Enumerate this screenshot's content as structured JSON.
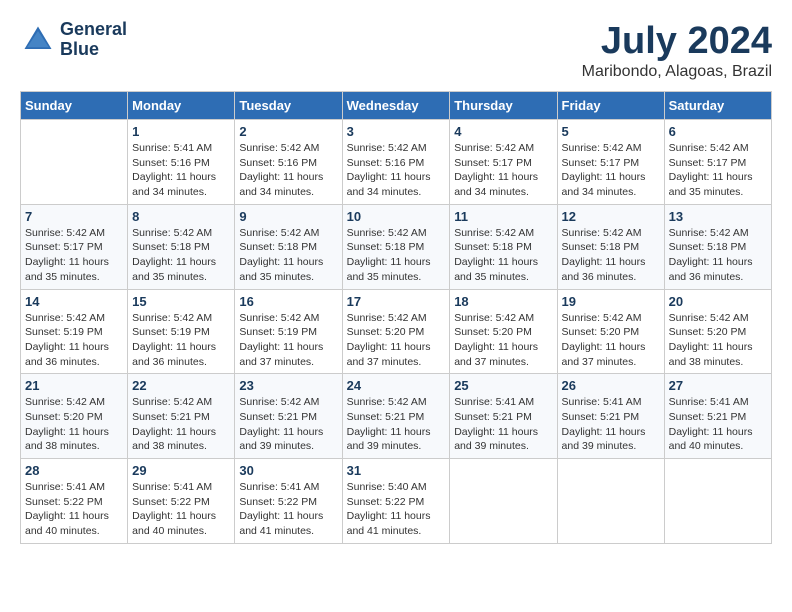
{
  "header": {
    "logo_line1": "General",
    "logo_line2": "Blue",
    "title": "July 2024",
    "subtitle": "Maribondo, Alagoas, Brazil"
  },
  "columns": [
    "Sunday",
    "Monday",
    "Tuesday",
    "Wednesday",
    "Thursday",
    "Friday",
    "Saturday"
  ],
  "weeks": [
    [
      {
        "day": "",
        "info": ""
      },
      {
        "day": "1",
        "info": "Sunrise: 5:41 AM\nSunset: 5:16 PM\nDaylight: 11 hours and 34 minutes."
      },
      {
        "day": "2",
        "info": "Sunrise: 5:42 AM\nSunset: 5:16 PM\nDaylight: 11 hours and 34 minutes."
      },
      {
        "day": "3",
        "info": "Sunrise: 5:42 AM\nSunset: 5:16 PM\nDaylight: 11 hours and 34 minutes."
      },
      {
        "day": "4",
        "info": "Sunrise: 5:42 AM\nSunset: 5:17 PM\nDaylight: 11 hours and 34 minutes."
      },
      {
        "day": "5",
        "info": "Sunrise: 5:42 AM\nSunset: 5:17 PM\nDaylight: 11 hours and 34 minutes."
      },
      {
        "day": "6",
        "info": "Sunrise: 5:42 AM\nSunset: 5:17 PM\nDaylight: 11 hours and 35 minutes."
      }
    ],
    [
      {
        "day": "7",
        "info": "Sunrise: 5:42 AM\nSunset: 5:17 PM\nDaylight: 11 hours and 35 minutes."
      },
      {
        "day": "8",
        "info": "Sunrise: 5:42 AM\nSunset: 5:18 PM\nDaylight: 11 hours and 35 minutes."
      },
      {
        "day": "9",
        "info": "Sunrise: 5:42 AM\nSunset: 5:18 PM\nDaylight: 11 hours and 35 minutes."
      },
      {
        "day": "10",
        "info": "Sunrise: 5:42 AM\nSunset: 5:18 PM\nDaylight: 11 hours and 35 minutes."
      },
      {
        "day": "11",
        "info": "Sunrise: 5:42 AM\nSunset: 5:18 PM\nDaylight: 11 hours and 35 minutes."
      },
      {
        "day": "12",
        "info": "Sunrise: 5:42 AM\nSunset: 5:18 PM\nDaylight: 11 hours and 36 minutes."
      },
      {
        "day": "13",
        "info": "Sunrise: 5:42 AM\nSunset: 5:18 PM\nDaylight: 11 hours and 36 minutes."
      }
    ],
    [
      {
        "day": "14",
        "info": "Sunrise: 5:42 AM\nSunset: 5:19 PM\nDaylight: 11 hours and 36 minutes."
      },
      {
        "day": "15",
        "info": "Sunrise: 5:42 AM\nSunset: 5:19 PM\nDaylight: 11 hours and 36 minutes."
      },
      {
        "day": "16",
        "info": "Sunrise: 5:42 AM\nSunset: 5:19 PM\nDaylight: 11 hours and 37 minutes."
      },
      {
        "day": "17",
        "info": "Sunrise: 5:42 AM\nSunset: 5:20 PM\nDaylight: 11 hours and 37 minutes."
      },
      {
        "day": "18",
        "info": "Sunrise: 5:42 AM\nSunset: 5:20 PM\nDaylight: 11 hours and 37 minutes."
      },
      {
        "day": "19",
        "info": "Sunrise: 5:42 AM\nSunset: 5:20 PM\nDaylight: 11 hours and 37 minutes."
      },
      {
        "day": "20",
        "info": "Sunrise: 5:42 AM\nSunset: 5:20 PM\nDaylight: 11 hours and 38 minutes."
      }
    ],
    [
      {
        "day": "21",
        "info": "Sunrise: 5:42 AM\nSunset: 5:20 PM\nDaylight: 11 hours and 38 minutes."
      },
      {
        "day": "22",
        "info": "Sunrise: 5:42 AM\nSunset: 5:21 PM\nDaylight: 11 hours and 38 minutes."
      },
      {
        "day": "23",
        "info": "Sunrise: 5:42 AM\nSunset: 5:21 PM\nDaylight: 11 hours and 39 minutes."
      },
      {
        "day": "24",
        "info": "Sunrise: 5:42 AM\nSunset: 5:21 PM\nDaylight: 11 hours and 39 minutes."
      },
      {
        "day": "25",
        "info": "Sunrise: 5:41 AM\nSunset: 5:21 PM\nDaylight: 11 hours and 39 minutes."
      },
      {
        "day": "26",
        "info": "Sunrise: 5:41 AM\nSunset: 5:21 PM\nDaylight: 11 hours and 39 minutes."
      },
      {
        "day": "27",
        "info": "Sunrise: 5:41 AM\nSunset: 5:21 PM\nDaylight: 11 hours and 40 minutes."
      }
    ],
    [
      {
        "day": "28",
        "info": "Sunrise: 5:41 AM\nSunset: 5:22 PM\nDaylight: 11 hours and 40 minutes."
      },
      {
        "day": "29",
        "info": "Sunrise: 5:41 AM\nSunset: 5:22 PM\nDaylight: 11 hours and 40 minutes."
      },
      {
        "day": "30",
        "info": "Sunrise: 5:41 AM\nSunset: 5:22 PM\nDaylight: 11 hours and 41 minutes."
      },
      {
        "day": "31",
        "info": "Sunrise: 5:40 AM\nSunset: 5:22 PM\nDaylight: 11 hours and 41 minutes."
      },
      {
        "day": "",
        "info": ""
      },
      {
        "day": "",
        "info": ""
      },
      {
        "day": "",
        "info": ""
      }
    ]
  ]
}
